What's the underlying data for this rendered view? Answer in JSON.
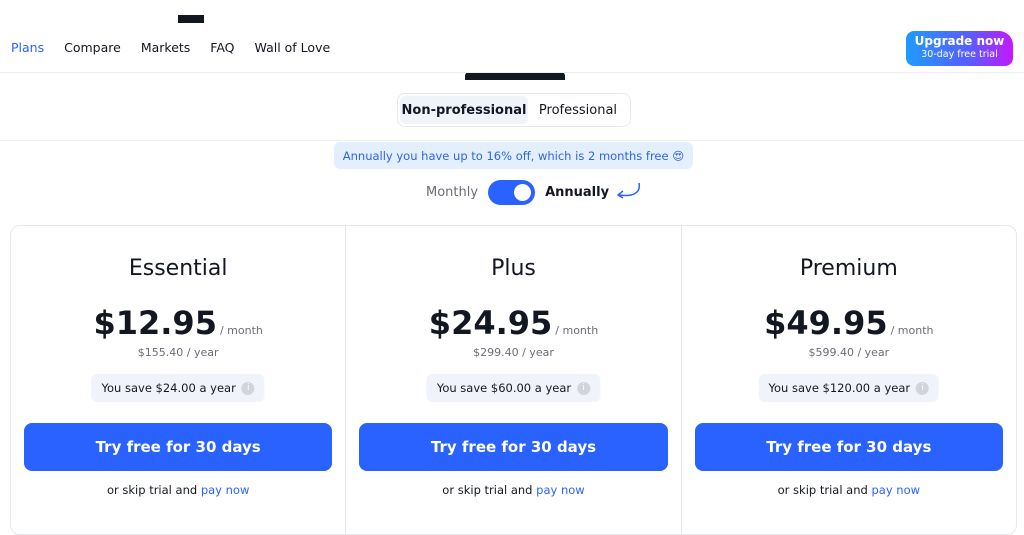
{
  "nav": {
    "links": [
      "Plans",
      "Compare",
      "Markets",
      "FAQ",
      "Wall of Love"
    ],
    "active": "Plans",
    "upgrade": {
      "title": "Upgrade now",
      "subtitle": "30-day free trial"
    }
  },
  "segment": {
    "options": [
      "Non-professional",
      "Professional"
    ],
    "selected": "Non-professional"
  },
  "banner": {
    "text": "Annually you have up to 16% off, which is 2 months free",
    "emoji": "😍"
  },
  "billing": {
    "monthly": "Monthly",
    "annually": "Annually",
    "selected": "Annually"
  },
  "plans": [
    {
      "name": "Essential",
      "price": "$12.95",
      "unit": "/ month",
      "yearly": "$155.40 / year",
      "save": "You save $24.00 a year",
      "cta": "Try free for 30 days",
      "skip": "or skip trial and",
      "pay": "pay now"
    },
    {
      "name": "Plus",
      "price": "$24.95",
      "unit": "/ month",
      "yearly": "$299.40 / year",
      "save": "You save $60.00 a year",
      "cta": "Try free for 30 days",
      "skip": "or skip trial and",
      "pay": "pay now"
    },
    {
      "name": "Premium",
      "price": "$49.95",
      "unit": "/ month",
      "yearly": "$599.40 / year",
      "save": "You save $120.00 a year",
      "cta": "Try free for 30 days",
      "skip": "or skip trial and",
      "pay": "pay now"
    }
  ],
  "colors": {
    "accent": "#2962ff",
    "banner_bg": "#e3effd"
  }
}
